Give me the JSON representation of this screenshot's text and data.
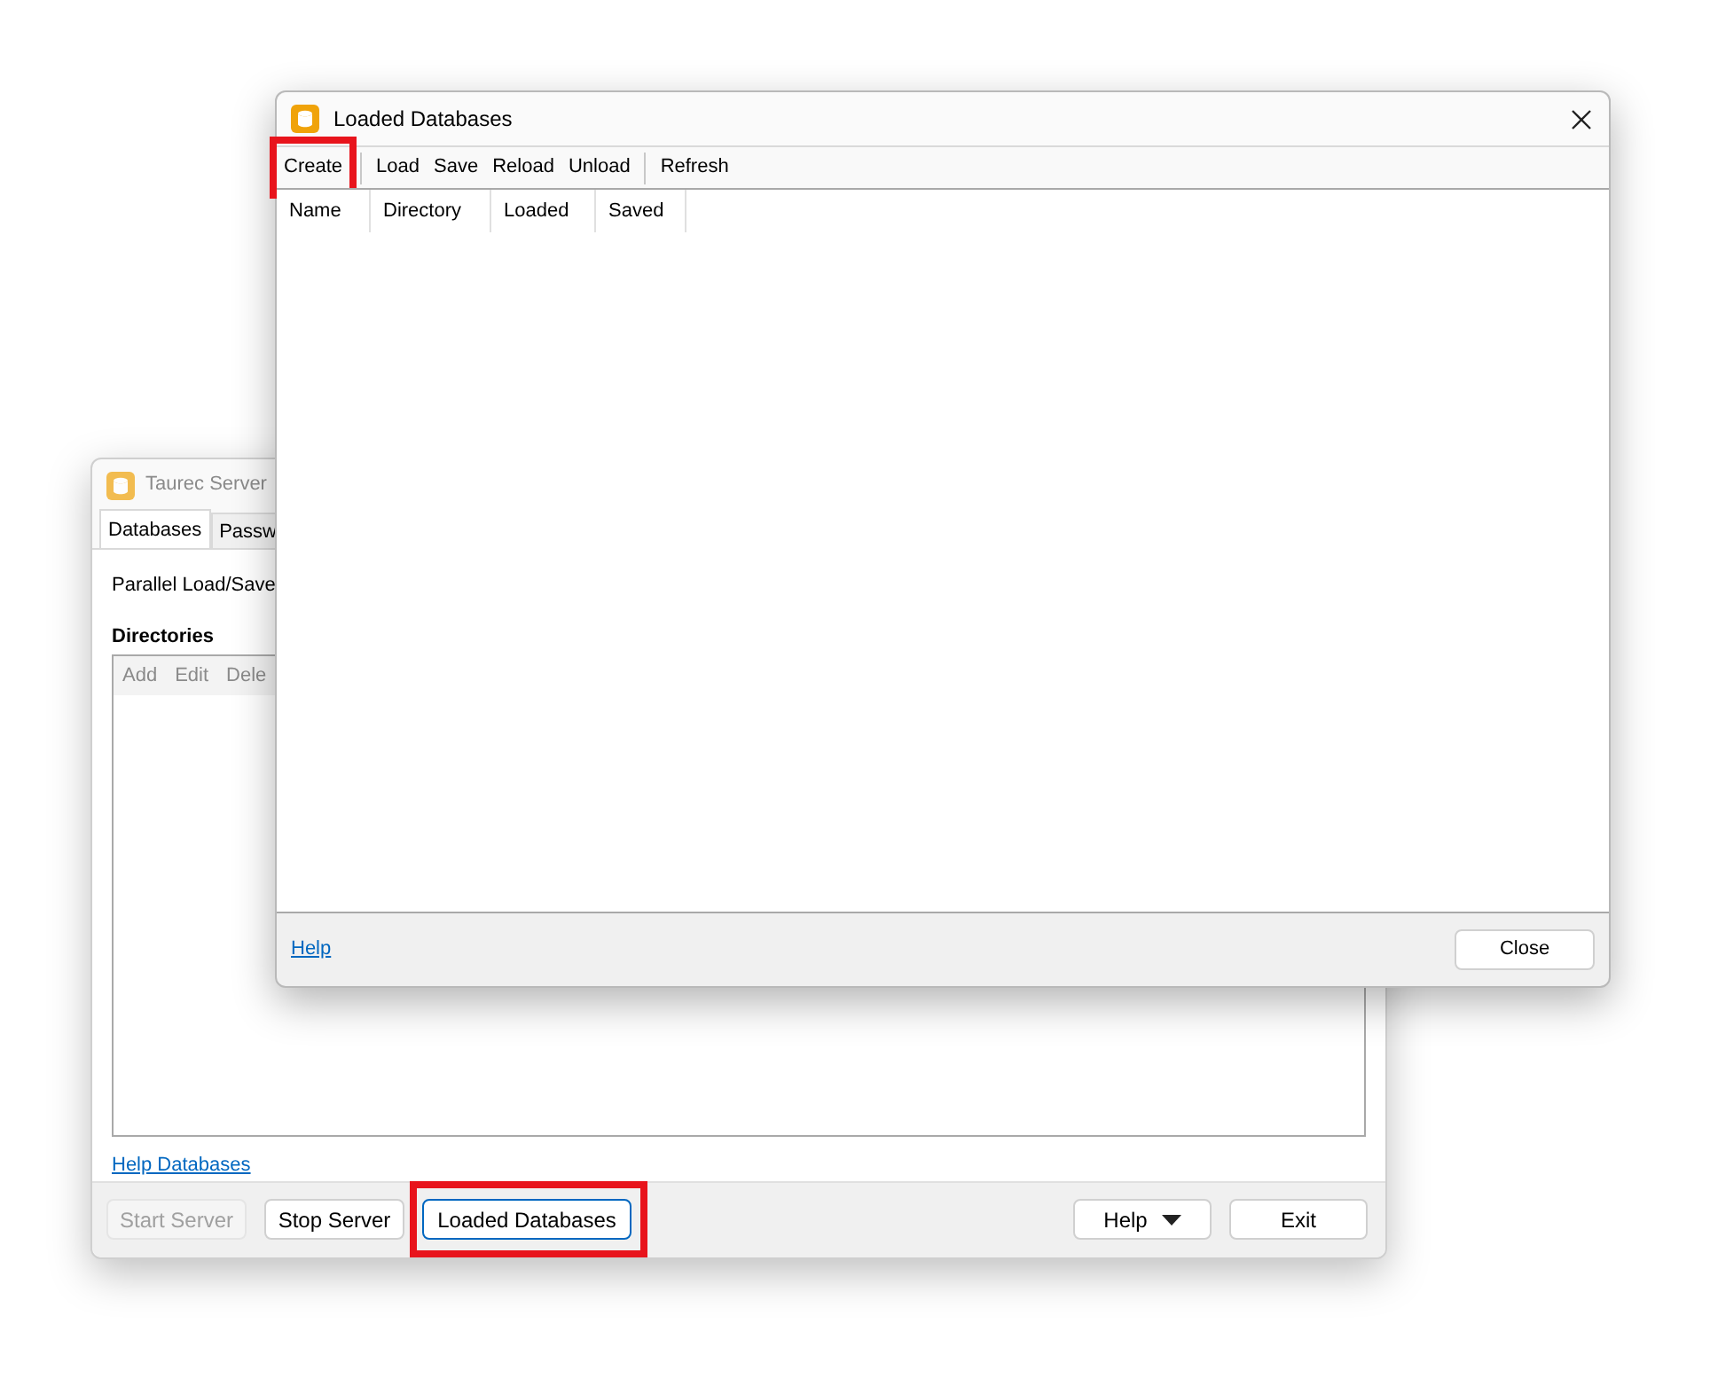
{
  "main_window": {
    "title": "Taurec Server",
    "active": false,
    "tabs": [
      {
        "label": "Databases",
        "selected": true
      },
      {
        "label": "Passw",
        "selected": false
      }
    ],
    "option_label": "Parallel Load/Save",
    "section_title": "Directories",
    "list_toolbar": [
      {
        "label": "Add",
        "disabled": true
      },
      {
        "label": "Edit",
        "disabled": true
      },
      {
        "label": "Dele",
        "disabled": true
      }
    ],
    "help_link": "Help Databases",
    "buttons": [
      {
        "label": "Start Server",
        "kind": "button",
        "disabled": true,
        "focused": false,
        "highlighted": false
      },
      {
        "label": "Stop Server",
        "kind": "button",
        "disabled": false,
        "focused": false,
        "highlighted": false
      },
      {
        "label": "Loaded Databases",
        "kind": "button",
        "disabled": false,
        "focused": true,
        "highlighted": true
      }
    ],
    "right_buttons": [
      {
        "label": "Help",
        "kind": "dropdown",
        "disabled": false,
        "focused": false,
        "highlighted": false
      },
      {
        "label": "Exit",
        "kind": "button",
        "disabled": false,
        "focused": false,
        "highlighted": false
      }
    ]
  },
  "dialog": {
    "title": "Loaded Databases",
    "active": true,
    "toolbar": [
      {
        "kind": "button",
        "label": "Create",
        "highlighted": true
      },
      {
        "kind": "separator"
      },
      {
        "kind": "button",
        "label": "Load",
        "highlighted": false
      },
      {
        "kind": "button",
        "label": "Save",
        "highlighted": false
      },
      {
        "kind": "button",
        "label": "Reload",
        "highlighted": false
      },
      {
        "kind": "button",
        "label": "Unload",
        "highlighted": false
      },
      {
        "kind": "separator"
      },
      {
        "kind": "button",
        "label": "Refresh",
        "highlighted": false
      }
    ],
    "columns": [
      "Name",
      "Directory",
      "Loaded",
      "Saved"
    ],
    "help_link": "Help",
    "close_button": "Close"
  }
}
